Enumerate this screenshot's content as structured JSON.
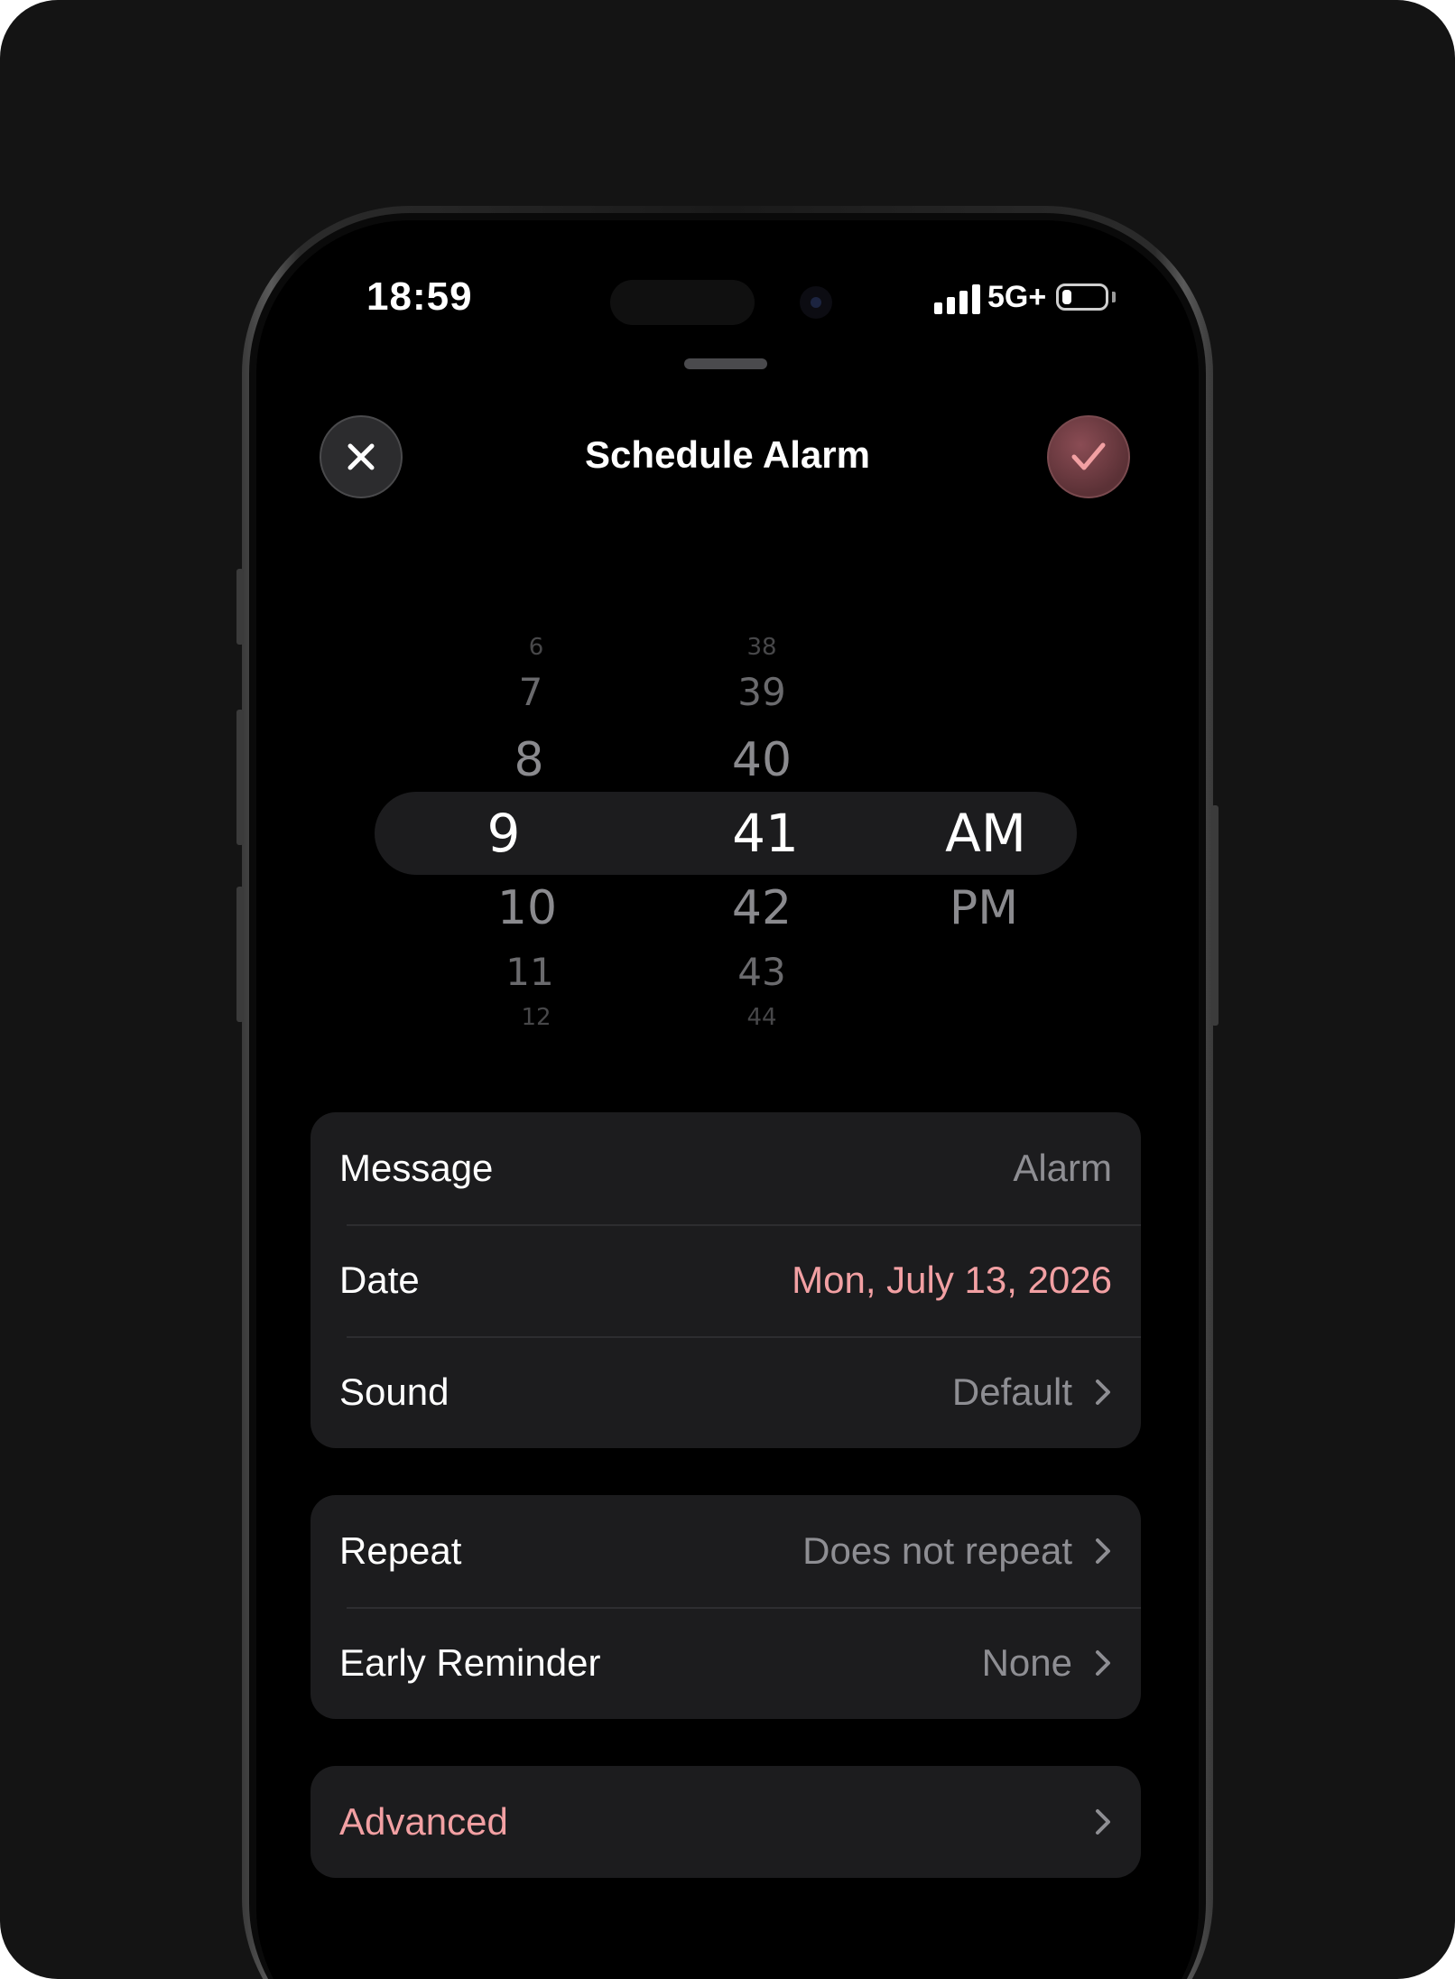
{
  "status": {
    "time": "18:59",
    "network": "5G+",
    "battery_level": 0.22
  },
  "header": {
    "title": "Schedule Alarm",
    "close_icon": "close-icon",
    "confirm_icon": "checkmark-icon"
  },
  "picker": {
    "hours": [
      "6",
      "7",
      "8",
      "9",
      "10",
      "11",
      "12"
    ],
    "minutes": [
      "38",
      "39",
      "40",
      "41",
      "42",
      "43",
      "44"
    ],
    "periods": [
      "AM",
      "PM"
    ],
    "selected": {
      "hour": "9",
      "minute": "41",
      "period": "AM"
    }
  },
  "settings": {
    "message": {
      "label": "Message",
      "value": "Alarm"
    },
    "date": {
      "label": "Date",
      "value": "Mon, July 13, 2026"
    },
    "sound": {
      "label": "Sound",
      "value": "Default"
    },
    "repeat": {
      "label": "Repeat",
      "value": "Does not repeat"
    },
    "early_reminder": {
      "label": "Early Reminder",
      "value": "None"
    },
    "advanced": {
      "label": "Advanced"
    }
  },
  "colors": {
    "background": "#000000",
    "group_background": "#1c1c1e",
    "accent": "#f2a0a3",
    "secondary_text": "#8e8e93"
  }
}
